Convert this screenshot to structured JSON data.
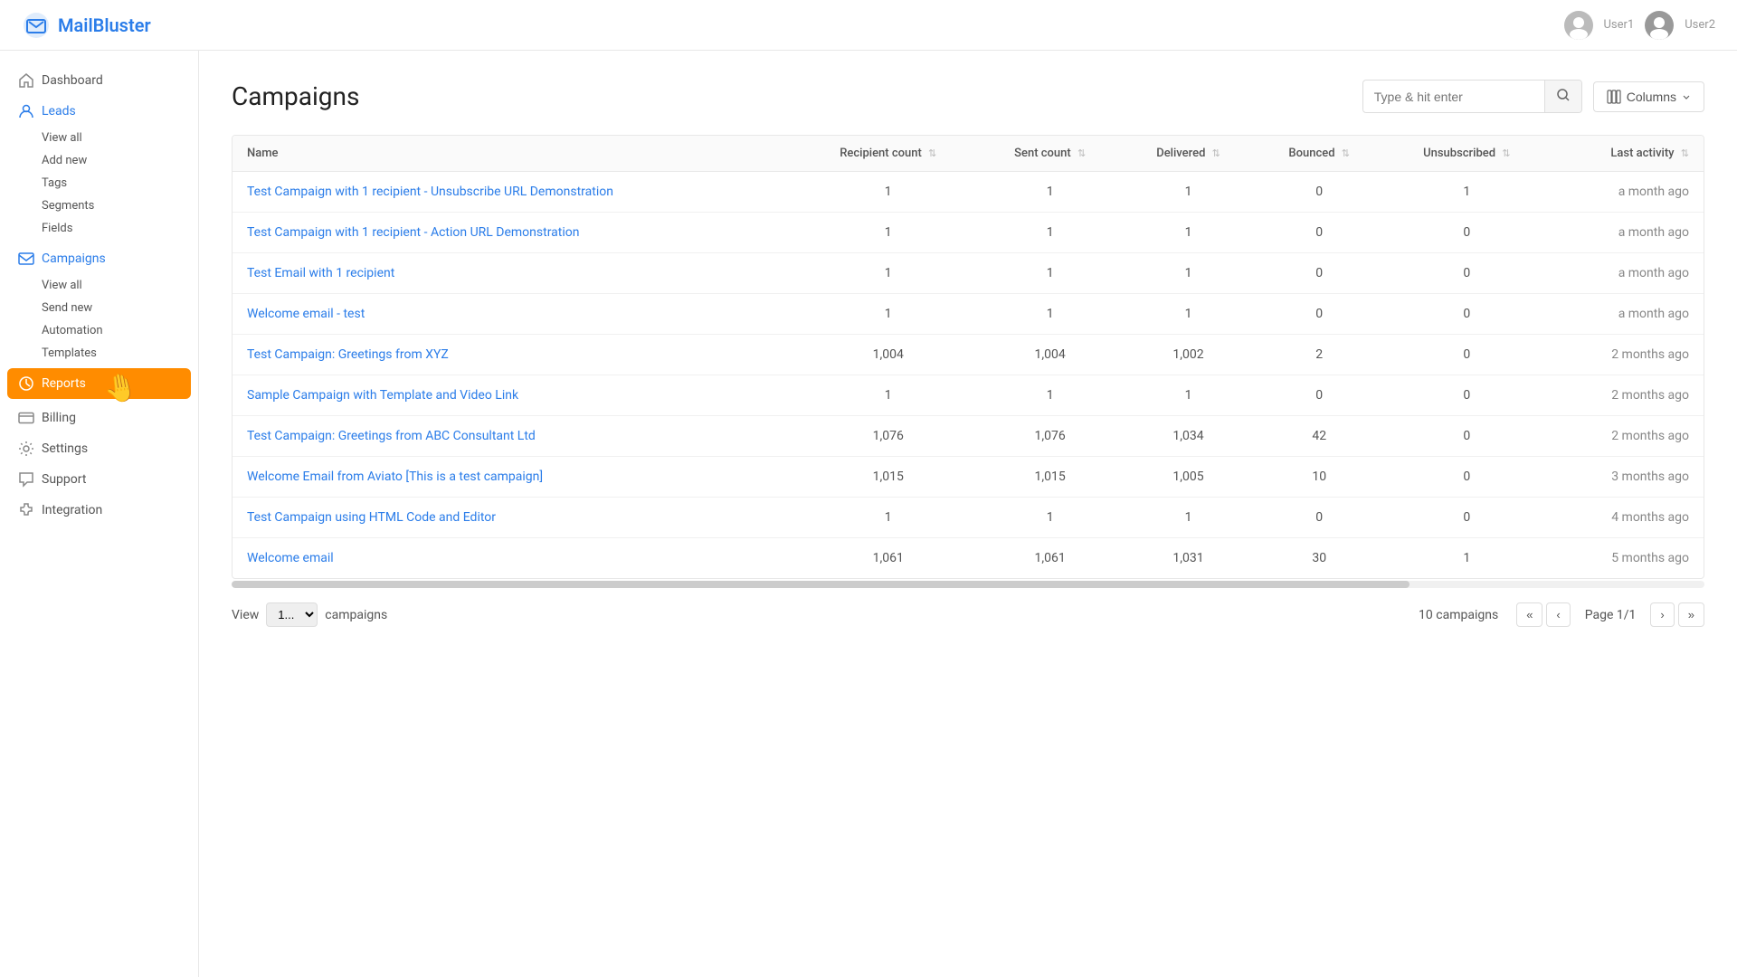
{
  "app": {
    "logo_text": "MailBluster",
    "title": "Campaigns"
  },
  "topbar": {
    "search_placeholder": "Type & hit enter",
    "columns_label": "Columns",
    "user1": "User1",
    "user2": "User2"
  },
  "sidebar": {
    "items": [
      {
        "id": "dashboard",
        "label": "Dashboard",
        "icon": "home"
      },
      {
        "id": "leads",
        "label": "Leads",
        "icon": "person"
      },
      {
        "id": "campaigns",
        "label": "Campaigns",
        "icon": "mail",
        "active": true
      },
      {
        "id": "reports",
        "label": "Reports",
        "icon": "chart",
        "highlighted": true
      },
      {
        "id": "billing",
        "label": "Billing",
        "icon": "credit-card"
      },
      {
        "id": "settings",
        "label": "Settings",
        "icon": "gear"
      },
      {
        "id": "support",
        "label": "Support",
        "icon": "chat"
      },
      {
        "id": "integration",
        "label": "Integration",
        "icon": "puzzle"
      }
    ],
    "leads_sub": [
      "View all",
      "Add new",
      "Tags",
      "Segments",
      "Fields"
    ],
    "campaigns_sub": [
      "View all",
      "Send new",
      "Automation",
      "Templates"
    ]
  },
  "table": {
    "columns": [
      {
        "id": "name",
        "label": "Name"
      },
      {
        "id": "recipient_count",
        "label": "Recipient count"
      },
      {
        "id": "sent_count",
        "label": "Sent count"
      },
      {
        "id": "delivered",
        "label": "Delivered"
      },
      {
        "id": "bounced",
        "label": "Bounced"
      },
      {
        "id": "unsubscribed",
        "label": "Unsubscribed"
      },
      {
        "id": "last_activity",
        "label": "Last activity"
      }
    ],
    "rows": [
      {
        "name": "Test Campaign with 1 recipient - Unsubscribe URL Demonstration",
        "recipient_count": "1",
        "sent_count": "1",
        "delivered": "1",
        "bounced": "0",
        "unsubscribed": "1",
        "last_activity": "a month ago"
      },
      {
        "name": "Test Campaign with 1 recipient - Action URL Demonstration",
        "recipient_count": "1",
        "sent_count": "1",
        "delivered": "1",
        "bounced": "0",
        "unsubscribed": "0",
        "last_activity": "a month ago"
      },
      {
        "name": "Test Email with 1 recipient",
        "recipient_count": "1",
        "sent_count": "1",
        "delivered": "1",
        "bounced": "0",
        "unsubscribed": "0",
        "last_activity": "a month ago"
      },
      {
        "name": "Welcome email - test",
        "recipient_count": "1",
        "sent_count": "1",
        "delivered": "1",
        "bounced": "0",
        "unsubscribed": "0",
        "last_activity": "a month ago"
      },
      {
        "name": "Test Campaign: Greetings from XYZ",
        "recipient_count": "1,004",
        "sent_count": "1,004",
        "delivered": "1,002",
        "bounced": "2",
        "unsubscribed": "0",
        "last_activity": "2 months ago"
      },
      {
        "name": "Sample Campaign with Template and Video Link",
        "recipient_count": "1",
        "sent_count": "1",
        "delivered": "1",
        "bounced": "0",
        "unsubscribed": "0",
        "last_activity": "2 months ago"
      },
      {
        "name": "Test Campaign: Greetings from ABC Consultant Ltd",
        "recipient_count": "1,076",
        "sent_count": "1,076",
        "delivered": "1,034",
        "bounced": "42",
        "unsubscribed": "0",
        "last_activity": "2 months ago"
      },
      {
        "name": "Welcome Email from Aviato [This is a test campaign]",
        "recipient_count": "1,015",
        "sent_count": "1,015",
        "delivered": "1,005",
        "bounced": "10",
        "unsubscribed": "0",
        "last_activity": "3 months ago"
      },
      {
        "name": "Test Campaign using HTML Code and Editor",
        "recipient_count": "1",
        "sent_count": "1",
        "delivered": "1",
        "bounced": "0",
        "unsubscribed": "0",
        "last_activity": "4 months ago"
      },
      {
        "name": "Welcome email",
        "recipient_count": "1,061",
        "sent_count": "1,061",
        "delivered": "1,031",
        "bounced": "30",
        "unsubscribed": "1",
        "last_activity": "5 months ago"
      }
    ]
  },
  "pagination": {
    "view_label": "View",
    "view_value": "1...",
    "campaigns_label": "campaigns",
    "total": "10 campaigns",
    "page_info": "Page 1/1"
  }
}
